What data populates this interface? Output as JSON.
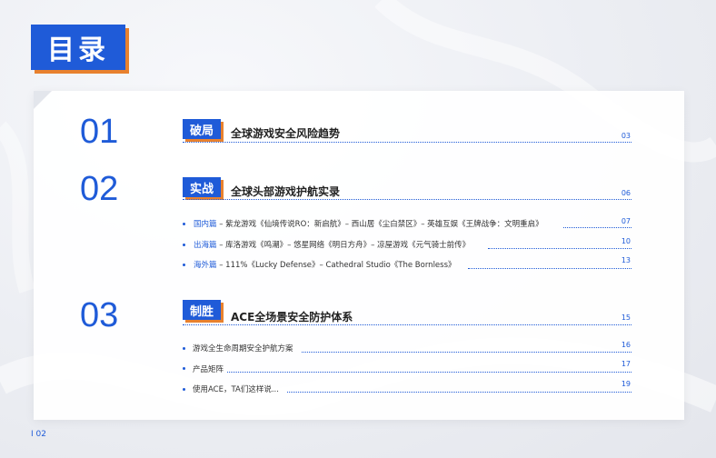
{
  "title": "目录",
  "sections": [
    {
      "num": "01",
      "tag": "破局",
      "title": "全球游戏安全风险趋势",
      "page": "03",
      "items": []
    },
    {
      "num": "02",
      "tag": "实战",
      "title": "全球头部游戏护航实录",
      "page": "06",
      "items": [
        {
          "label": "国内篇",
          "text": " – 紫龙游戏《仙境传说RO：新启航》– 西山居《尘白禁区》– 英雄互娱《王牌战争：文明重启》",
          "page": "07"
        },
        {
          "label": "出海篇",
          "text": " – 库洛游戏《鸣潮》– 悠星网络《明日方舟》– 凉屋游戏《元气骑士前传》",
          "page": "10"
        },
        {
          "label": "海外篇",
          "text": " – 111%《Lucky Defense》– Cathedral Studio《The Bornless》",
          "page": "13"
        }
      ]
    },
    {
      "num": "03",
      "tag": "制胜",
      "title": "ACE全场景安全防护体系",
      "page": "15",
      "items": [
        {
          "label": "",
          "text": "游戏全生命周期安全护航方案",
          "page": "16"
        },
        {
          "label": "",
          "text": "产品矩阵",
          "page": "17"
        },
        {
          "label": "",
          "text": "使用ACE，TA们这样说...",
          "page": "19"
        }
      ]
    }
  ],
  "footer": {
    "page": "I 02"
  }
}
